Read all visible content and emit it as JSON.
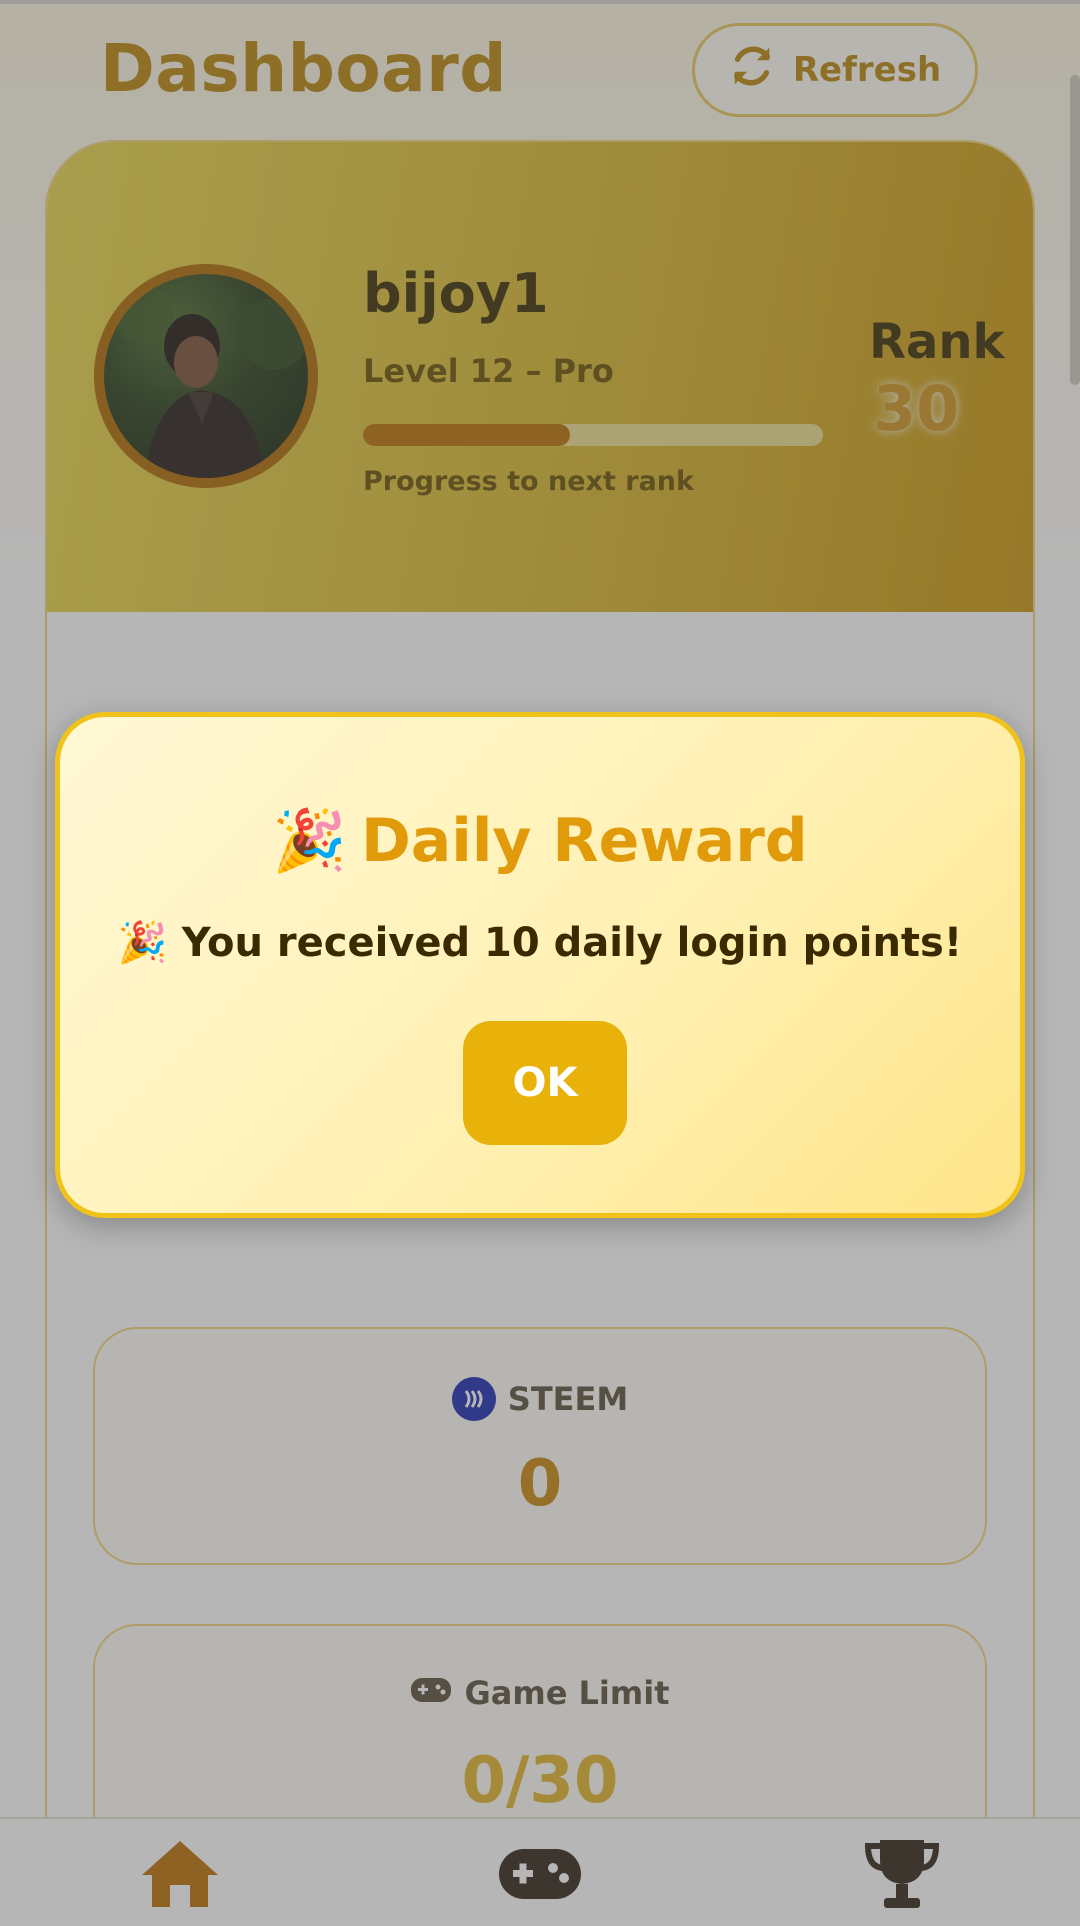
{
  "header": {
    "title": "Dashboard",
    "refresh_label": "Refresh"
  },
  "profile": {
    "username": "bijoy1",
    "level_text": "Level 12 – Pro",
    "progress": 0.45,
    "progress_label": "Progress to next rank",
    "rank_label": "Rank",
    "rank_value": "30"
  },
  "stats": [
    {
      "title": "STEEM",
      "value": "0",
      "icon": "steem-icon"
    },
    {
      "title": "Game Limit",
      "value": "0/30",
      "icon": "gamepad-icon"
    }
  ],
  "modal": {
    "title": "Daily Reward",
    "title_emoji": "🎉",
    "message": "You received 10 daily login points!",
    "message_emoji": "🎉",
    "ok_label": "OK"
  },
  "nav": {
    "items": [
      "home-icon",
      "gamepad-icon",
      "trophy-icon"
    ]
  },
  "colors": {
    "accent": "#b8860b",
    "button": "#e9b20b",
    "modal_border": "#f1c21a"
  }
}
